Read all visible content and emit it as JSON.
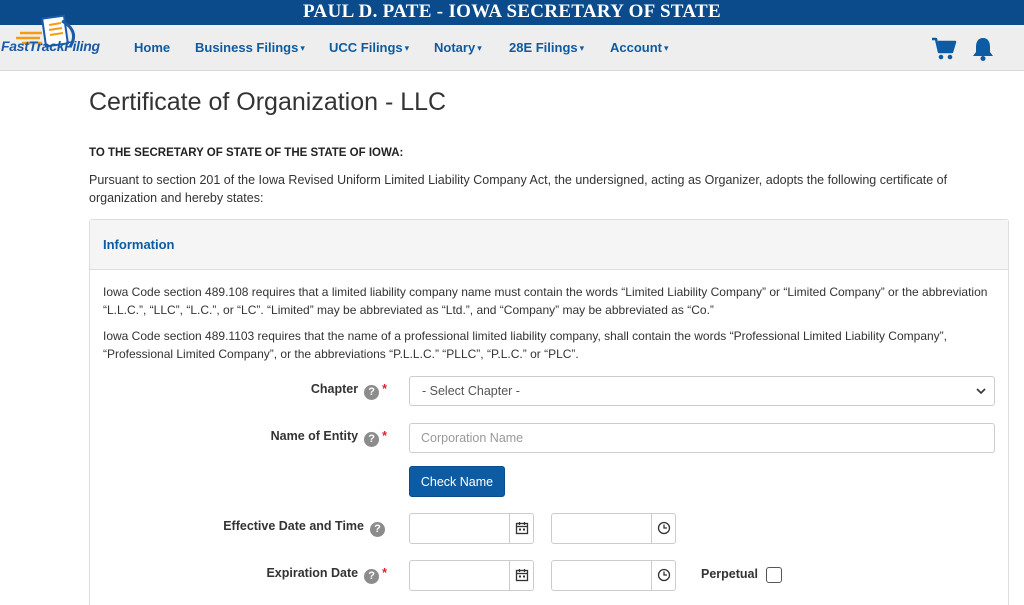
{
  "banner": {
    "title": "PAUL D. PATE - IOWA SECRETARY OF STATE"
  },
  "brand": {
    "logo_text": "FastTrackFiling"
  },
  "nav": {
    "home": "Home",
    "business_filings": "Business Filings",
    "ucc_filings": "UCC Filings",
    "notary": "Notary",
    "filings_28e": "28E Filings",
    "account": "Account",
    "caret": "▾"
  },
  "icons": {
    "cart": "cart-icon",
    "bell": "bell-icon",
    "help": "help-icon",
    "calendar": "calendar-icon",
    "clock": "clock-icon"
  },
  "colors": {
    "brand_blue": "#0b4a8b",
    "link_blue": "#0d5ca3",
    "required_red": "#d9252b"
  },
  "page": {
    "title": "Certificate of Organization - LLC",
    "to_heading": "TO THE SECRETARY OF STATE OF THE STATE OF IOWA:",
    "intro": "Pursuant to section 201 of the Iowa Revised Uniform Limited Liability Company Act, the undersigned, acting as Organizer, adopts the following certificate of organization and hereby states:"
  },
  "panel": {
    "heading": "Information",
    "code_1": "Iowa Code section 489.108 requires that a limited liability company name must contain the words “Limited Liability Company” or “Limited Company” or the abbreviation “L.L.C.”, “LLC”, “L.C.”, or “LC”. “Limited” may be abbreviated as “Ltd.”, and “Company” may be abbreviated as “Co.”",
    "code_2": "Iowa Code section 489.1103 requires that the name of a professional limited liability company, shall contain the words “Professional Limited Liability Company”, “Professional Limited Company”, or the abbreviations “P.L.L.C.” “PLLC”, “P.L.C.” or “PLC”."
  },
  "form": {
    "help_glyph": "?",
    "required_mark": "*",
    "chapter": {
      "label": "Chapter",
      "selected": "- Select Chapter -"
    },
    "entity_name": {
      "label": "Name of Entity",
      "placeholder": "Corporation Name",
      "value": ""
    },
    "check_name_button": "Check Name",
    "effective": {
      "label": "Effective Date and Time",
      "date": "",
      "time": ""
    },
    "expiration": {
      "label": "Expiration Date",
      "date": "",
      "time": ""
    },
    "perpetual": {
      "label": "Perpetual",
      "checked": false
    }
  }
}
